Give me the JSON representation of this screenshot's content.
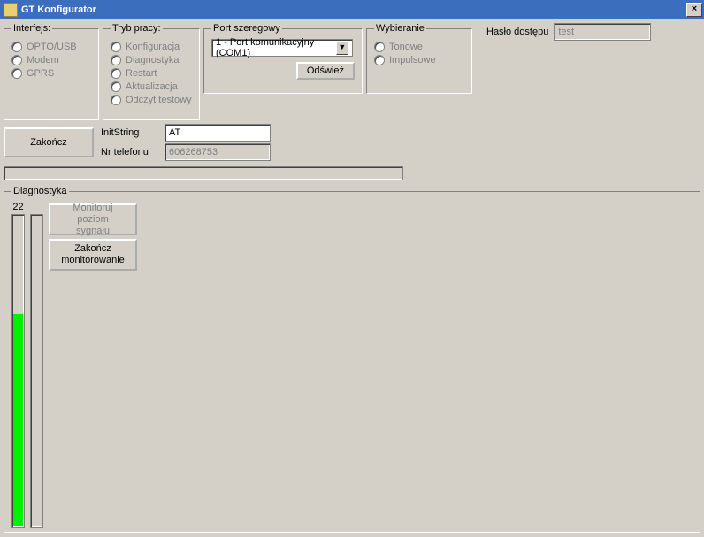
{
  "window": {
    "title": "GT Konfigurator",
    "close_glyph": "×"
  },
  "interfejs": {
    "legend": "Interfejs:",
    "options": [
      "OPTO/USB",
      "Modem",
      "GPRS"
    ]
  },
  "tryb": {
    "legend": "Tryb pracy:",
    "options": [
      "Konfiguracja",
      "Diagnostyka",
      "Restart",
      "Aktualizacja",
      "Odczyt testowy"
    ]
  },
  "port": {
    "legend": "Port szeregowy",
    "selected": "1 - Port komunikacyjny (COM1)",
    "refresh": "Odśwież"
  },
  "wyb": {
    "legend": "Wybieranie",
    "options": [
      "Tonowe",
      "Impulsowe"
    ]
  },
  "password": {
    "label": "Hasło dostępu",
    "value": "test"
  },
  "actions": {
    "zakoncz": "Zakończ"
  },
  "init": {
    "label": "InitString",
    "value": "AT"
  },
  "tel": {
    "label": "Nr telefonu",
    "value": "606268753"
  },
  "diag": {
    "legend": "Diagnostyka",
    "signal_value": "22",
    "monitor_btn": "Monitoruj poziom sygnału",
    "stop_btn": "Zakończ monitorowanie"
  }
}
